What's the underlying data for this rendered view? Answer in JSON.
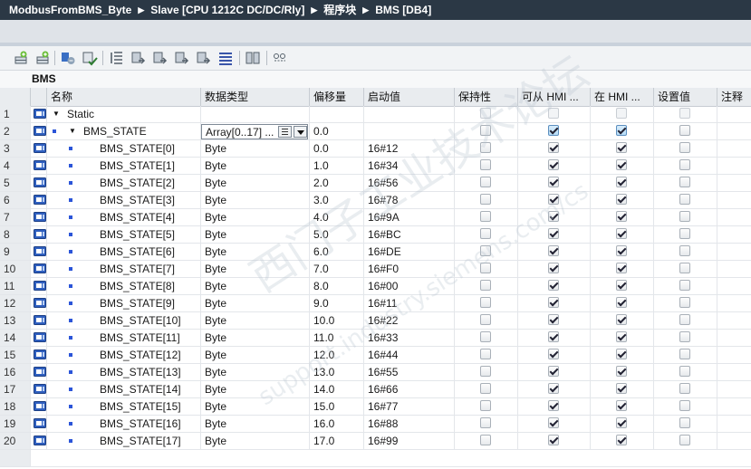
{
  "breadcrumb": [
    "ModbusFromBMS_Byte",
    "Slave [CPU 1212C DC/DC/Rly]",
    "程序块",
    "BMS [DB4]"
  ],
  "block_name": "BMS",
  "toolbar_icons": [
    "insert-row-icon",
    "add-row-icon",
    "show-all-icon",
    "expand-icon",
    "reset-start-values-icon",
    "snapshot-icon",
    "copy-snapshot-icon",
    "load-start-values-icon",
    "apply-snapshot-icon",
    "list-icon",
    "keep-actual-values-icon",
    "show-comments-icon"
  ],
  "columns": [
    "名称",
    "数据类型",
    "偏移量",
    "启动值",
    "保持性",
    "可从 HMI ...",
    "在 HMI ...",
    "设置值",
    "注释"
  ],
  "rows": [
    {
      "num": "1",
      "name": "Static",
      "type": "",
      "offset": "",
      "start": "",
      "level": 0,
      "expander": "▼",
      "retain": false,
      "hmi_access": false,
      "hmi_visible": false,
      "setpoint": false,
      "is_static": true
    },
    {
      "num": "2",
      "name": "BMS_STATE",
      "type": "Array[0..17] ...",
      "offset": "0.0",
      "start": "",
      "level": 1,
      "expander": "▼",
      "retain": false,
      "hmi_access": true,
      "hmi_visible": true,
      "setpoint": false,
      "is_array": true
    },
    {
      "num": "3",
      "name": "BMS_STATE[0]",
      "type": "Byte",
      "offset": "0.0",
      "start": "16#12",
      "level": 2,
      "retain": false,
      "hmi_access": true,
      "hmi_visible": true,
      "setpoint": false
    },
    {
      "num": "4",
      "name": "BMS_STATE[1]",
      "type": "Byte",
      "offset": "1.0",
      "start": "16#34",
      "level": 2,
      "retain": false,
      "hmi_access": true,
      "hmi_visible": true,
      "setpoint": false
    },
    {
      "num": "5",
      "name": "BMS_STATE[2]",
      "type": "Byte",
      "offset": "2.0",
      "start": "16#56",
      "level": 2,
      "retain": false,
      "hmi_access": true,
      "hmi_visible": true,
      "setpoint": false
    },
    {
      "num": "6",
      "name": "BMS_STATE[3]",
      "type": "Byte",
      "offset": "3.0",
      "start": "16#78",
      "level": 2,
      "retain": false,
      "hmi_access": true,
      "hmi_visible": true,
      "setpoint": false
    },
    {
      "num": "7",
      "name": "BMS_STATE[4]",
      "type": "Byte",
      "offset": "4.0",
      "start": "16#9A",
      "level": 2,
      "retain": false,
      "hmi_access": true,
      "hmi_visible": true,
      "setpoint": false
    },
    {
      "num": "8",
      "name": "BMS_STATE[5]",
      "type": "Byte",
      "offset": "5.0",
      "start": "16#BC",
      "level": 2,
      "retain": false,
      "hmi_access": true,
      "hmi_visible": true,
      "setpoint": false
    },
    {
      "num": "9",
      "name": "BMS_STATE[6]",
      "type": "Byte",
      "offset": "6.0",
      "start": "16#DE",
      "level": 2,
      "retain": false,
      "hmi_access": true,
      "hmi_visible": true,
      "setpoint": false
    },
    {
      "num": "10",
      "name": "BMS_STATE[7]",
      "type": "Byte",
      "offset": "7.0",
      "start": "16#F0",
      "level": 2,
      "retain": false,
      "hmi_access": true,
      "hmi_visible": true,
      "setpoint": false
    },
    {
      "num": "11",
      "name": "BMS_STATE[8]",
      "type": "Byte",
      "offset": "8.0",
      "start": "16#00",
      "level": 2,
      "retain": false,
      "hmi_access": true,
      "hmi_visible": true,
      "setpoint": false
    },
    {
      "num": "12",
      "name": "BMS_STATE[9]",
      "type": "Byte",
      "offset": "9.0",
      "start": "16#11",
      "level": 2,
      "retain": false,
      "hmi_access": true,
      "hmi_visible": true,
      "setpoint": false
    },
    {
      "num": "13",
      "name": "BMS_STATE[10]",
      "type": "Byte",
      "offset": "10.0",
      "start": "16#22",
      "level": 2,
      "retain": false,
      "hmi_access": true,
      "hmi_visible": true,
      "setpoint": false
    },
    {
      "num": "14",
      "name": "BMS_STATE[11]",
      "type": "Byte",
      "offset": "11.0",
      "start": "16#33",
      "level": 2,
      "retain": false,
      "hmi_access": true,
      "hmi_visible": true,
      "setpoint": false
    },
    {
      "num": "15",
      "name": "BMS_STATE[12]",
      "type": "Byte",
      "offset": "12.0",
      "start": "16#44",
      "level": 2,
      "retain": false,
      "hmi_access": true,
      "hmi_visible": true,
      "setpoint": false
    },
    {
      "num": "16",
      "name": "BMS_STATE[13]",
      "type": "Byte",
      "offset": "13.0",
      "start": "16#55",
      "level": 2,
      "retain": false,
      "hmi_access": true,
      "hmi_visible": true,
      "setpoint": false
    },
    {
      "num": "17",
      "name": "BMS_STATE[14]",
      "type": "Byte",
      "offset": "14.0",
      "start": "16#66",
      "level": 2,
      "retain": false,
      "hmi_access": true,
      "hmi_visible": true,
      "setpoint": false
    },
    {
      "num": "18",
      "name": "BMS_STATE[15]",
      "type": "Byte",
      "offset": "15.0",
      "start": "16#77",
      "level": 2,
      "retain": false,
      "hmi_access": true,
      "hmi_visible": true,
      "setpoint": false
    },
    {
      "num": "19",
      "name": "BMS_STATE[16]",
      "type": "Byte",
      "offset": "16.0",
      "start": "16#88",
      "level": 2,
      "retain": false,
      "hmi_access": true,
      "hmi_visible": true,
      "setpoint": false
    },
    {
      "num": "20",
      "name": "BMS_STATE[17]",
      "type": "Byte",
      "offset": "17.0",
      "start": "16#99",
      "level": 2,
      "retain": false,
      "hmi_access": true,
      "hmi_visible": true,
      "setpoint": false
    }
  ],
  "watermark": {
    "line1": "西门子工业技术论坛",
    "line2": "support.industry.siemens.com/cs"
  },
  "colors": {
    "titlebar": "#2b3845",
    "accent_blue": "#2b55d8",
    "checkbox_blue": "#b6dcf7"
  }
}
